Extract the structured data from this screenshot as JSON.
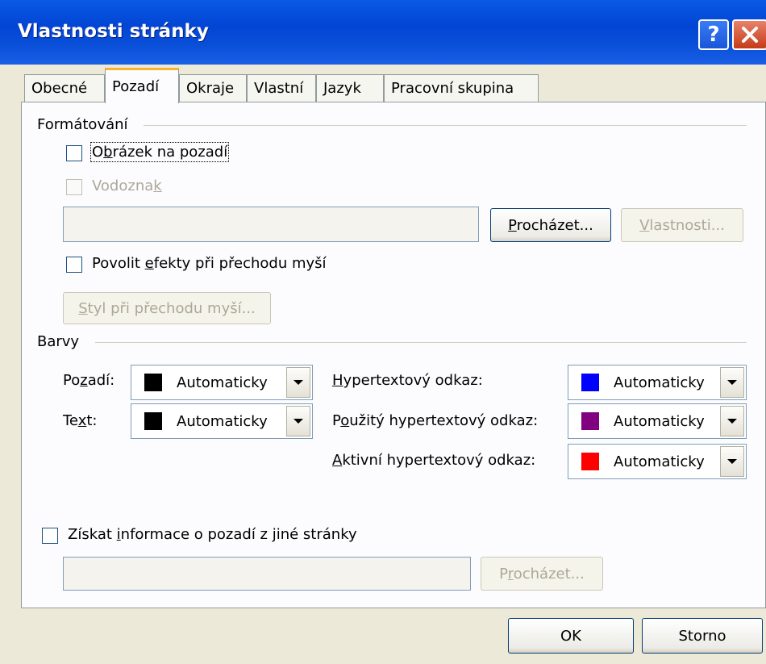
{
  "window": {
    "title": "Vlastnosti stránky"
  },
  "tabs": [
    {
      "label": "Obecné"
    },
    {
      "label": "Pozadí"
    },
    {
      "label": "Okraje"
    },
    {
      "label": "Vlastní"
    },
    {
      "label": "Jazyk"
    },
    {
      "label": "Pracovní skupina"
    }
  ],
  "formatting": {
    "title": "Formátování",
    "background_image": {
      "label_pre": "O",
      "label_u": "b",
      "label_post": "rázek na pozadí",
      "checked": false
    },
    "watermark": {
      "label_pre": "Vodozna",
      "label_u": "k",
      "label_post": "",
      "checked": false,
      "disabled": true
    },
    "path_value": "",
    "browse_btn": {
      "u": "P",
      "rest": "rocházet..."
    },
    "properties_btn": {
      "u": "V",
      "rest": "lastnosti..."
    },
    "hover_effects": {
      "label_pre": "Povolit ",
      "label_u": "e",
      "label_post": "fekty při přechodu myší",
      "checked": false
    },
    "hover_style_btn": {
      "u": "S",
      "rest": "tyl při přechodu myší..."
    }
  },
  "colors": {
    "title": "Barvy",
    "background": {
      "label_pre": "Po",
      "label_u": "z",
      "label_post": "adí:",
      "value": "Automaticky",
      "swatch": "#000000"
    },
    "text": {
      "label_pre": "Te",
      "label_u": "x",
      "label_post": "t:",
      "value": "Automaticky",
      "swatch": "#000000"
    },
    "hyperlink": {
      "label_pre": "",
      "label_u": "H",
      "label_post": "ypertextový odkaz:",
      "value": "Automaticky",
      "swatch": "#0000ff"
    },
    "visited": {
      "label_pre": "P",
      "label_u": "o",
      "label_post": "užitý hypertextový odkaz:",
      "value": "Automaticky",
      "swatch": "#800080"
    },
    "active": {
      "label_pre": "",
      "label_u": "A",
      "label_post": "ktivní hypertextový odkaz:",
      "value": "Automaticky",
      "swatch": "#ff0000"
    }
  },
  "other_page": {
    "label_pre": "Získat ",
    "label_u": "i",
    "label_post": "nformace o pozadí z jiné stránky",
    "checked": false,
    "path_value": "",
    "browse_btn": {
      "pre": "P",
      "u": "r",
      "rest": "ocházet..."
    }
  },
  "footer": {
    "ok": "OK",
    "cancel": "Storno"
  },
  "theme": {
    "titlebar": "#0245d5",
    "tab_highlight": "#f8b330",
    "dialog_bg": "#ece9d8"
  }
}
